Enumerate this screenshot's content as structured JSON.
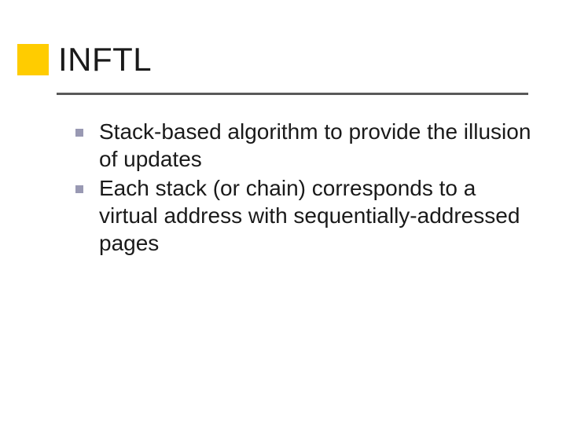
{
  "title": "INFTL",
  "bullets": [
    "Stack-based algorithm to provide the illusion of updates",
    "Each stack (or chain) corresponds to a virtual address with sequentially-addressed pages"
  ]
}
